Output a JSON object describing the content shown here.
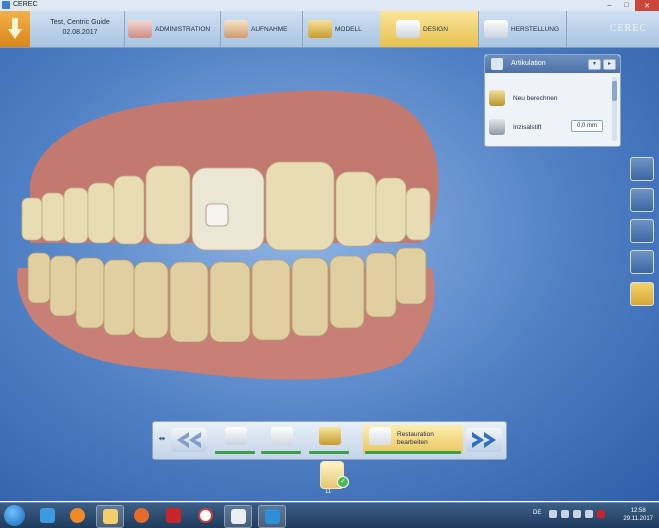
{
  "window": {
    "title": "CEREC",
    "minimize": "–",
    "maximize": "□",
    "close": "✕"
  },
  "patient": {
    "name": "Test, Centric Guide",
    "date": "02.08.2017"
  },
  "nav": {
    "steps": [
      {
        "label": "ADMINISTRATION"
      },
      {
        "label": "AUFNAHME"
      },
      {
        "label": "MODELL"
      },
      {
        "label": "DESIGN"
      },
      {
        "label": "HERSTELLUNG"
      }
    ],
    "active": "DESIGN",
    "logo": "CEREC"
  },
  "panel": {
    "title": "Artikulation",
    "rows": [
      {
        "label": "Neu berechnen"
      },
      {
        "label": "Inzisalstift"
      }
    ],
    "value": "0,0 mm"
  },
  "stepbar": {
    "active_label": "Restauration bearbeiten",
    "prev": "«",
    "next": "»"
  },
  "tooth": {
    "number": "11",
    "check": "✓"
  },
  "taskbar": {
    "language": "DE",
    "time": "12:58",
    "date": "29.11.2017"
  },
  "colors": {
    "accent": "#e7c14f",
    "viewport_bg": "#4f7fc4",
    "progress": "#3aa04b",
    "gingiva": "#c87a72",
    "teeth": "#e8dcb4"
  }
}
